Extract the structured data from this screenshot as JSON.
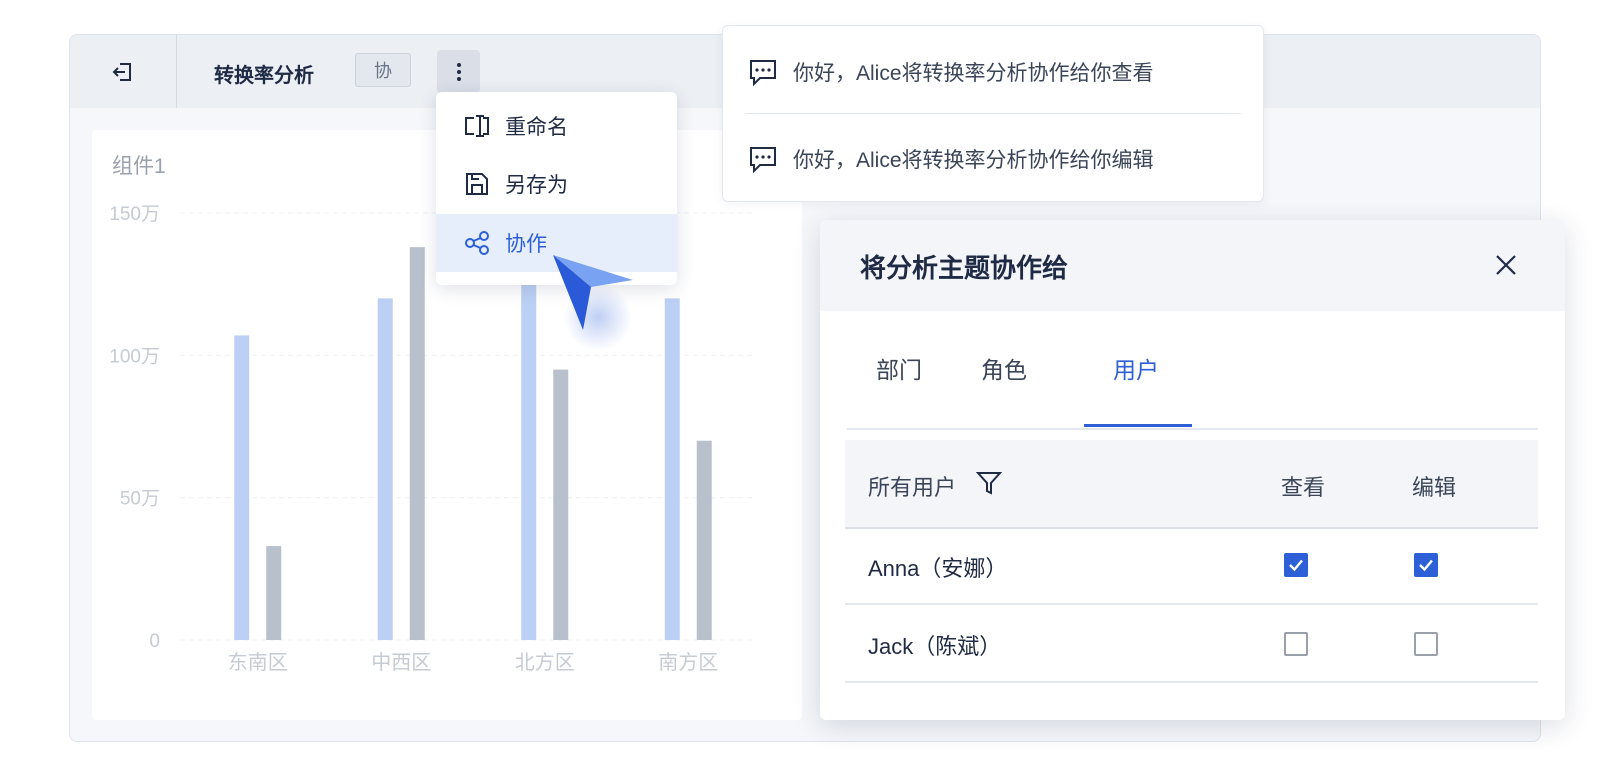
{
  "topbar": {
    "title": "转换率分析",
    "collab_tag": "协"
  },
  "widget": {
    "title": "组件1"
  },
  "chart_data": {
    "type": "bar",
    "title": "",
    "categories": [
      "东南区",
      "中西区",
      "北方区",
      "南方区"
    ],
    "y_ticks": [
      "0",
      "50万",
      "100万",
      "150万"
    ],
    "ylim": [
      0,
      1500000
    ],
    "grid": true,
    "colors": [
      "#bcd0f5",
      "#b8c0cc"
    ],
    "series": [
      {
        "values": [
          1070000,
          1200000,
          1260000,
          1200000
        ]
      },
      {
        "values": [
          330000,
          1380000,
          950000,
          700000
        ]
      }
    ]
  },
  "menu": {
    "items": [
      {
        "label": "重命名",
        "icon": "rename-icon"
      },
      {
        "label": "另存为",
        "icon": "save-as-icon"
      },
      {
        "label": "协作",
        "icon": "share-icon"
      }
    ]
  },
  "notifications": [
    {
      "text": "你好，Alice将转换率分析协作给你查看",
      "icon": "message-icon"
    },
    {
      "text": "你好，Alice将转换率分析协作给你编辑",
      "icon": "message-icon"
    }
  ],
  "dialog": {
    "title": "将分析主题协作给",
    "tabs": [
      "部门",
      "角色",
      "用户"
    ],
    "active_tab": "用户",
    "table": {
      "headers": {
        "user": "所有用户",
        "view": "查看",
        "edit": "编辑"
      },
      "rows": [
        {
          "name": "Anna（安娜）",
          "view": true,
          "edit": true
        },
        {
          "name": "Jack（陈斌）",
          "view": false,
          "edit": false
        }
      ]
    }
  },
  "colors": {
    "accent": "#2d5fd6",
    "text": "#1f2a44"
  }
}
